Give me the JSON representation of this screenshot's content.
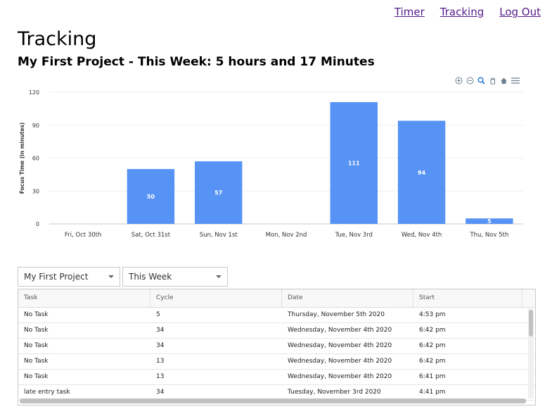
{
  "nav": {
    "timer": "Timer",
    "tracking": "Tracking",
    "logout": "Log Out"
  },
  "page": {
    "title": "Tracking",
    "subtitle": "My First Project - This Week: 5 hours and 17 Minutes"
  },
  "toolbar": [
    "zoom-in-icon",
    "zoom-out-icon",
    "zoom-select-icon",
    "pan-icon",
    "home-icon",
    "menu-icon"
  ],
  "chart_data": {
    "type": "bar",
    "categories": [
      "Fri, Oct 30th",
      "Sat, Oct 31st",
      "Sun, Nov 1st",
      "Mon, Nov 2nd",
      "Tue, Nov 3rd",
      "Wed, Nov 4th",
      "Thu, Nov 5th"
    ],
    "values": [
      0,
      50,
      57,
      0,
      111,
      94,
      5
    ],
    "ylabel": "Focus Time (in minutes)",
    "ylim": [
      0,
      120
    ],
    "yticks": [
      "0",
      "30",
      "60",
      "90",
      "120"
    ],
    "bar_color": "#5693f5",
    "grid": true
  },
  "filters": {
    "project": "My First Project",
    "range": "This Week"
  },
  "table": {
    "headers": [
      "Task",
      "Cycle",
      "Date",
      "Start"
    ],
    "rows": [
      [
        "No Task",
        "5",
        "Thursday, November 5th 2020",
        "4:53 pm"
      ],
      [
        "No Task",
        "34",
        "Wednesday, November 4th 2020",
        "6:42 pm"
      ],
      [
        "No Task",
        "34",
        "Wednesday, November 4th 2020",
        "6:42 pm"
      ],
      [
        "No Task",
        "13",
        "Wednesday, November 4th 2020",
        "6:42 pm"
      ],
      [
        "No Task",
        "13",
        "Wednesday, November 4th 2020",
        "6:41 pm"
      ],
      [
        "late entry task",
        "34",
        "Tuesday, November 3rd 2020",
        "4:41 pm"
      ]
    ]
  }
}
